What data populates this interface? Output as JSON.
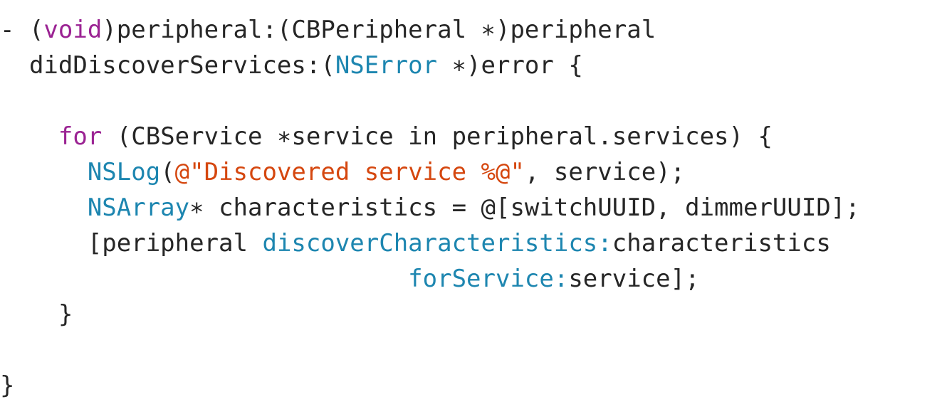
{
  "code": {
    "lines": [
      [
        {
          "text": "- (",
          "kind": "plain"
        },
        {
          "text": "void",
          "kind": "keyword"
        },
        {
          "text": ")peripheral:(CBPeripheral ∗)peripheral",
          "kind": "plain"
        }
      ],
      [
        {
          "text": "  didDiscoverServices:(",
          "kind": "plain"
        },
        {
          "text": "NSError",
          "kind": "type"
        },
        {
          "text": " ∗)error {",
          "kind": "plain"
        }
      ],
      [],
      [
        {
          "text": "    ",
          "kind": "plain"
        },
        {
          "text": "for",
          "kind": "keyword"
        },
        {
          "text": " (CBService ∗service in peripheral.services) {",
          "kind": "plain"
        }
      ],
      [
        {
          "text": "      ",
          "kind": "plain"
        },
        {
          "text": "NSLog",
          "kind": "type"
        },
        {
          "text": "(",
          "kind": "plain"
        },
        {
          "text": "@\"Discovered service %@\"",
          "kind": "string"
        },
        {
          "text": ", service);",
          "kind": "plain"
        }
      ],
      [
        {
          "text": "      ",
          "kind": "plain"
        },
        {
          "text": "NSArray",
          "kind": "type"
        },
        {
          "text": "∗ characteristics = @[switchUUID, dimmerUUID];",
          "kind": "plain"
        }
      ],
      [
        {
          "text": "      [peripheral ",
          "kind": "plain"
        },
        {
          "text": "discoverCharacteristics:",
          "kind": "method"
        },
        {
          "text": "characteristics",
          "kind": "plain"
        }
      ],
      [
        {
          "text": "                            ",
          "kind": "plain"
        },
        {
          "text": "forService:",
          "kind": "method"
        },
        {
          "text": "service];",
          "kind": "plain"
        }
      ],
      [
        {
          "text": "    }",
          "kind": "plain"
        }
      ],
      [],
      [
        {
          "text": "}",
          "kind": "plain"
        }
      ]
    ]
  }
}
